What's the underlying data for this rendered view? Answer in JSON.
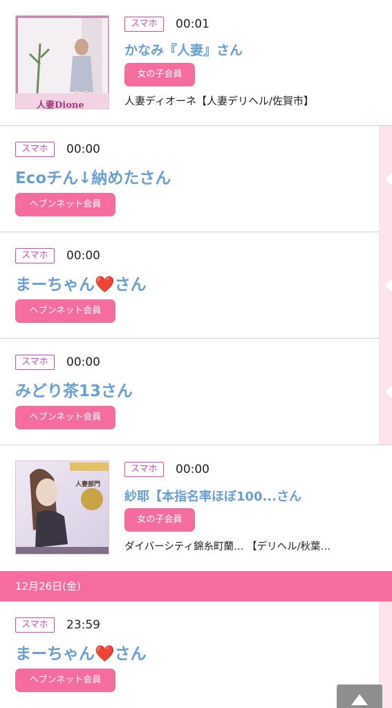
{
  "entries": [
    {
      "device": "スマホ",
      "time": "00:01",
      "name": "かなみ『人妻』さん",
      "member": "女の子会員",
      "shop": "人妻ディオーネ【人妻デリヘル/佐賀市】",
      "thumb_text": "人妻Dione"
    },
    {
      "device": "スマホ",
      "time": "00:00",
      "name": "Ecoチん↓納めたさん",
      "member": "ヘブンネット会員"
    },
    {
      "device": "スマホ",
      "time": "00:00",
      "name": "まーちゃん❤️さん",
      "member": "ヘブンネット会員"
    },
    {
      "device": "スマホ",
      "time": "00:00",
      "name": "みどり茶13さん",
      "member": "ヘブンネット会員"
    },
    {
      "device": "スマホ",
      "time": "00:00",
      "name": "紗耶【本指名率ほぼ100...さん",
      "member": "女の子会員",
      "shop": "ダイバーシティ錦糸町蘭…  【デリヘル/秋葉…",
      "thumb_text": "人妻部門"
    }
  ],
  "date_header": "12月26日(金)",
  "entries_after": [
    {
      "device": "スマホ",
      "time": "23:59",
      "name": "まーちゃん❤️さん",
      "member": "ヘブンネット会員"
    }
  ],
  "scroll_top_icon": "arrow-up-icon"
}
